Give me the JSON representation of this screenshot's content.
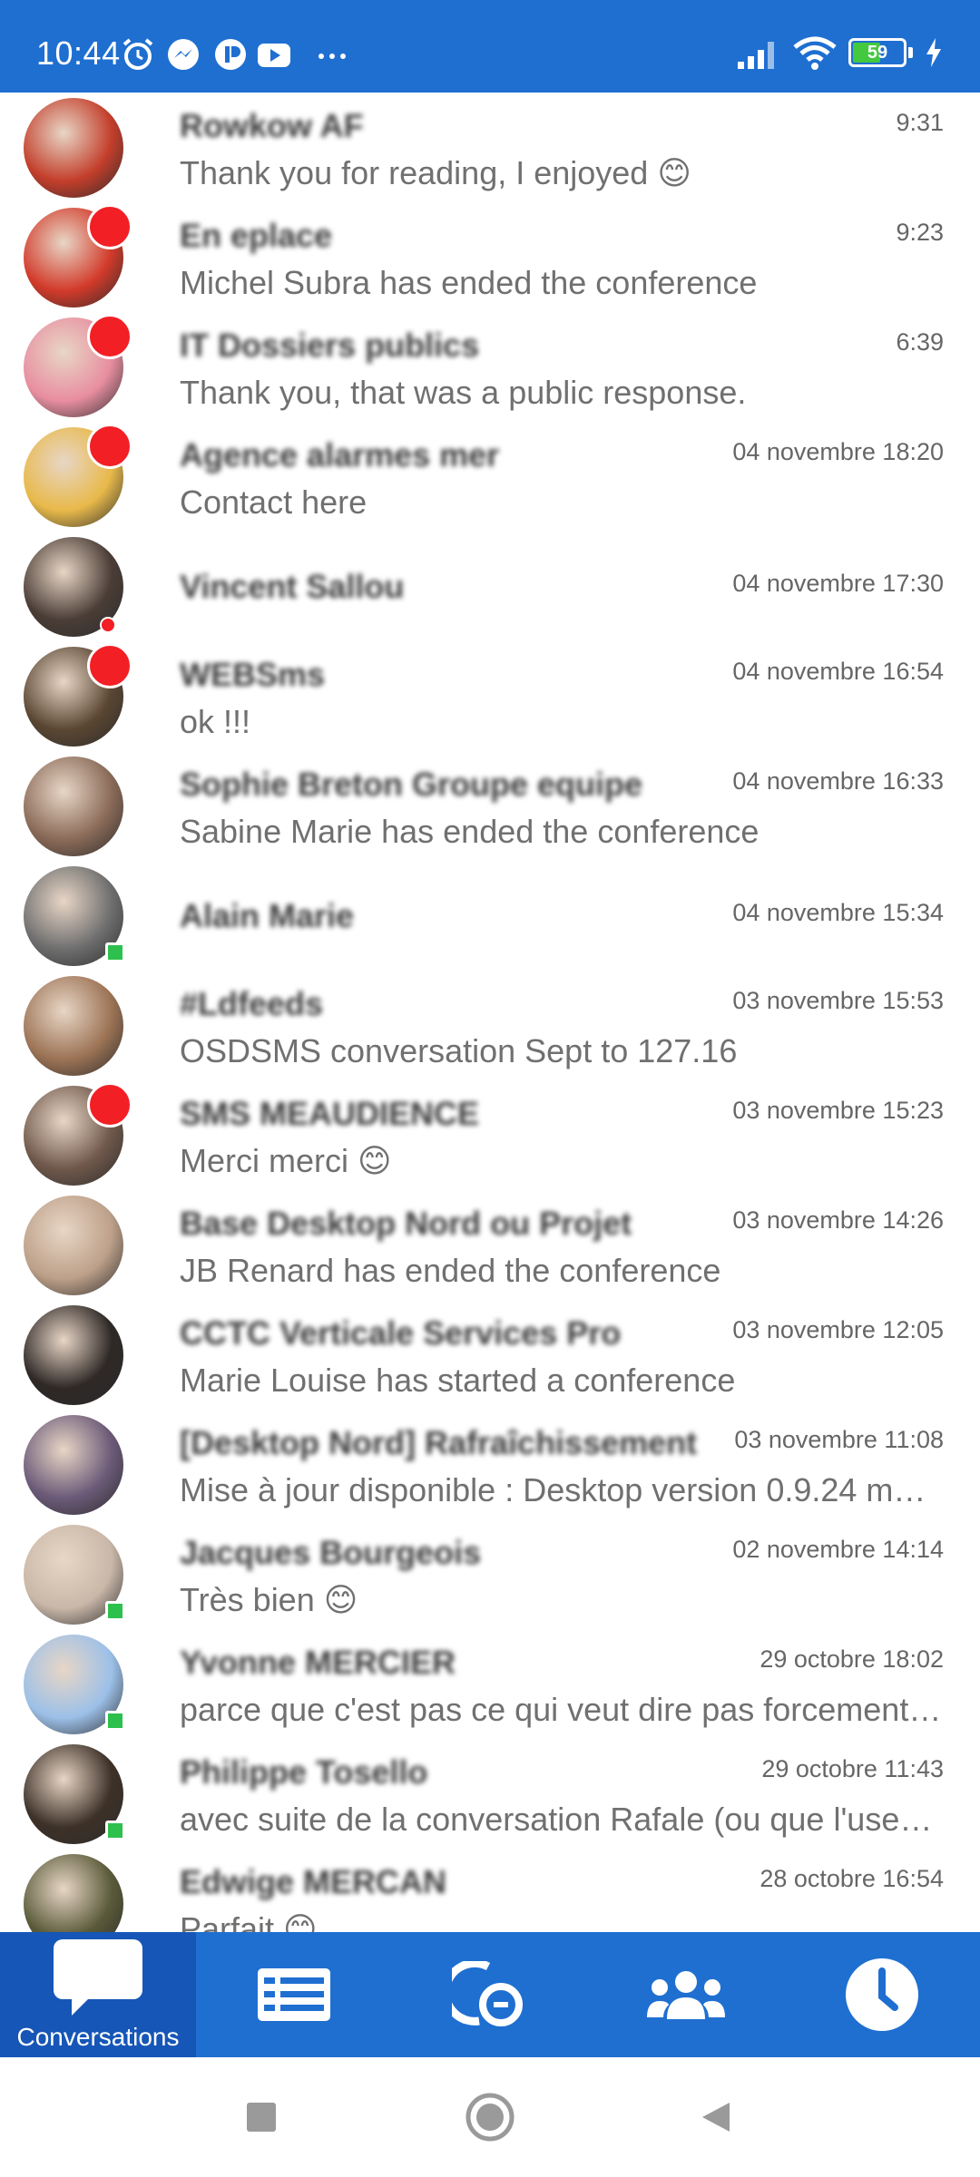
{
  "status_bar": {
    "time": "10:44",
    "battery": "59",
    "battery_level": 0.59,
    "notification_icons": [
      "alarm-icon",
      "messenger-icon",
      "app-icon",
      "youtube-icon",
      "more-icon"
    ],
    "status_icons": [
      "signal-icon",
      "wifi-icon",
      "battery-icon",
      "charging-icon"
    ]
  },
  "conversations": [
    {
      "name": "Rowkow AF",
      "preview": "Thank you for reading, I enjoyed 😊",
      "time": "9:31",
      "badge": false,
      "online": false,
      "avatar_color": "#c33e2b"
    },
    {
      "name": "En eplace",
      "preview": "Michel Subra has ended the conference",
      "time": "9:23",
      "badge": true,
      "online": false,
      "avatar_color": "#d23a2a"
    },
    {
      "name": "IT Dossiers publics",
      "preview": "Thank you, that was a public response.",
      "time": "6:39",
      "badge": true,
      "online": false,
      "avatar_color": "#e88ea0"
    },
    {
      "name": "Agence alarmes mer",
      "preview": "Contact here",
      "time": "04 novembre 18:20",
      "badge": true,
      "online": false,
      "avatar_color": "#e8b94a"
    },
    {
      "name": "Vincent Sallou",
      "preview": "",
      "time": "04 novembre 17:30",
      "badge": false,
      "online": false,
      "avatar_color": "#4a3d36",
      "dot": true
    },
    {
      "name": "WEBSms",
      "preview": "ok !!!",
      "time": "04 novembre 16:54",
      "badge": true,
      "online": false,
      "avatar_color": "#5a4632"
    },
    {
      "name": "Sophie Breton Groupe equipe",
      "preview": "Sabine Marie has ended the conference",
      "time": "04 novembre 16:33",
      "badge": false,
      "online": false,
      "avatar_color": "#8a6a58"
    },
    {
      "name": "Alain Marie",
      "preview": "",
      "time": "04 novembre 15:34",
      "badge": false,
      "online": true,
      "avatar_color": "#6e6e6e"
    },
    {
      "name": "#Ldfeeds",
      "preview": "OSDSMS conversation Sept to 127.16",
      "time": "03 novembre 15:53",
      "badge": false,
      "online": false,
      "avatar_color": "#9c7355"
    },
    {
      "name": "SMS MEAUDIENCE",
      "preview": "Merci merci 😊",
      "time": "03 novembre 15:23",
      "badge": true,
      "online": false,
      "avatar_color": "#6f584b"
    },
    {
      "name": "Base Desktop Nord ou Projet",
      "preview": "JB Renard has ended the conference",
      "time": "03 novembre 14:26",
      "badge": false,
      "online": false,
      "avatar_color": "#bda089"
    },
    {
      "name": "CCTC Verticale Services Pro",
      "preview": "Marie Louise has started a conference",
      "time": "03 novembre 12:05",
      "badge": false,
      "online": false,
      "avatar_color": "#2e2826"
    },
    {
      "name": "[Desktop Nord] Rafraîchissement",
      "preview": "Mise à jour disponible : Desktop version 0.9.24 m…",
      "time": "03 novembre 11:08",
      "badge": false,
      "online": false,
      "avatar_color": "#6b5a78"
    },
    {
      "name": "Jacques Bourgeois",
      "preview": "Très bien 😊",
      "time": "02 novembre 14:14",
      "badge": false,
      "online": true,
      "avatar_color": "#c9b7a8"
    },
    {
      "name": "Yvonne MERCIER",
      "preview": "parce que c'est pas ce qui veut dire pas forcement …",
      "time": "29 octobre 18:02",
      "badge": false,
      "online": true,
      "avatar_color": "#9cc0e8"
    },
    {
      "name": "Philippe Tosello",
      "preview": "avec suite de la conversation Rafale (ou que l'use…",
      "time": "29 octobre 11:43",
      "badge": false,
      "online": true,
      "avatar_color": "#3d3128"
    },
    {
      "name": "Edwige MERCAN",
      "preview": "Parfait 😊",
      "time": "28 octobre 16:54",
      "badge": false,
      "online": false,
      "avatar_color": "#5a5a3a"
    }
  ],
  "bottom_nav": {
    "tabs": [
      {
        "label": "Conversations",
        "icon": "chat-bubble-icon",
        "active": true
      },
      {
        "label": "",
        "icon": "news-list-icon",
        "active": false
      },
      {
        "label": "",
        "icon": "call-search-icon",
        "active": false
      },
      {
        "label": "",
        "icon": "contacts-group-icon",
        "active": false
      },
      {
        "label": "",
        "icon": "clock-icon",
        "active": false
      }
    ]
  },
  "system_nav": {
    "buttons": [
      "recents-icon",
      "home-icon",
      "back-icon"
    ]
  },
  "colors": {
    "primary": "#1f6fd1",
    "active_tab": "#1656b7",
    "badge": "#f21f25",
    "online": "#2ec04d"
  }
}
